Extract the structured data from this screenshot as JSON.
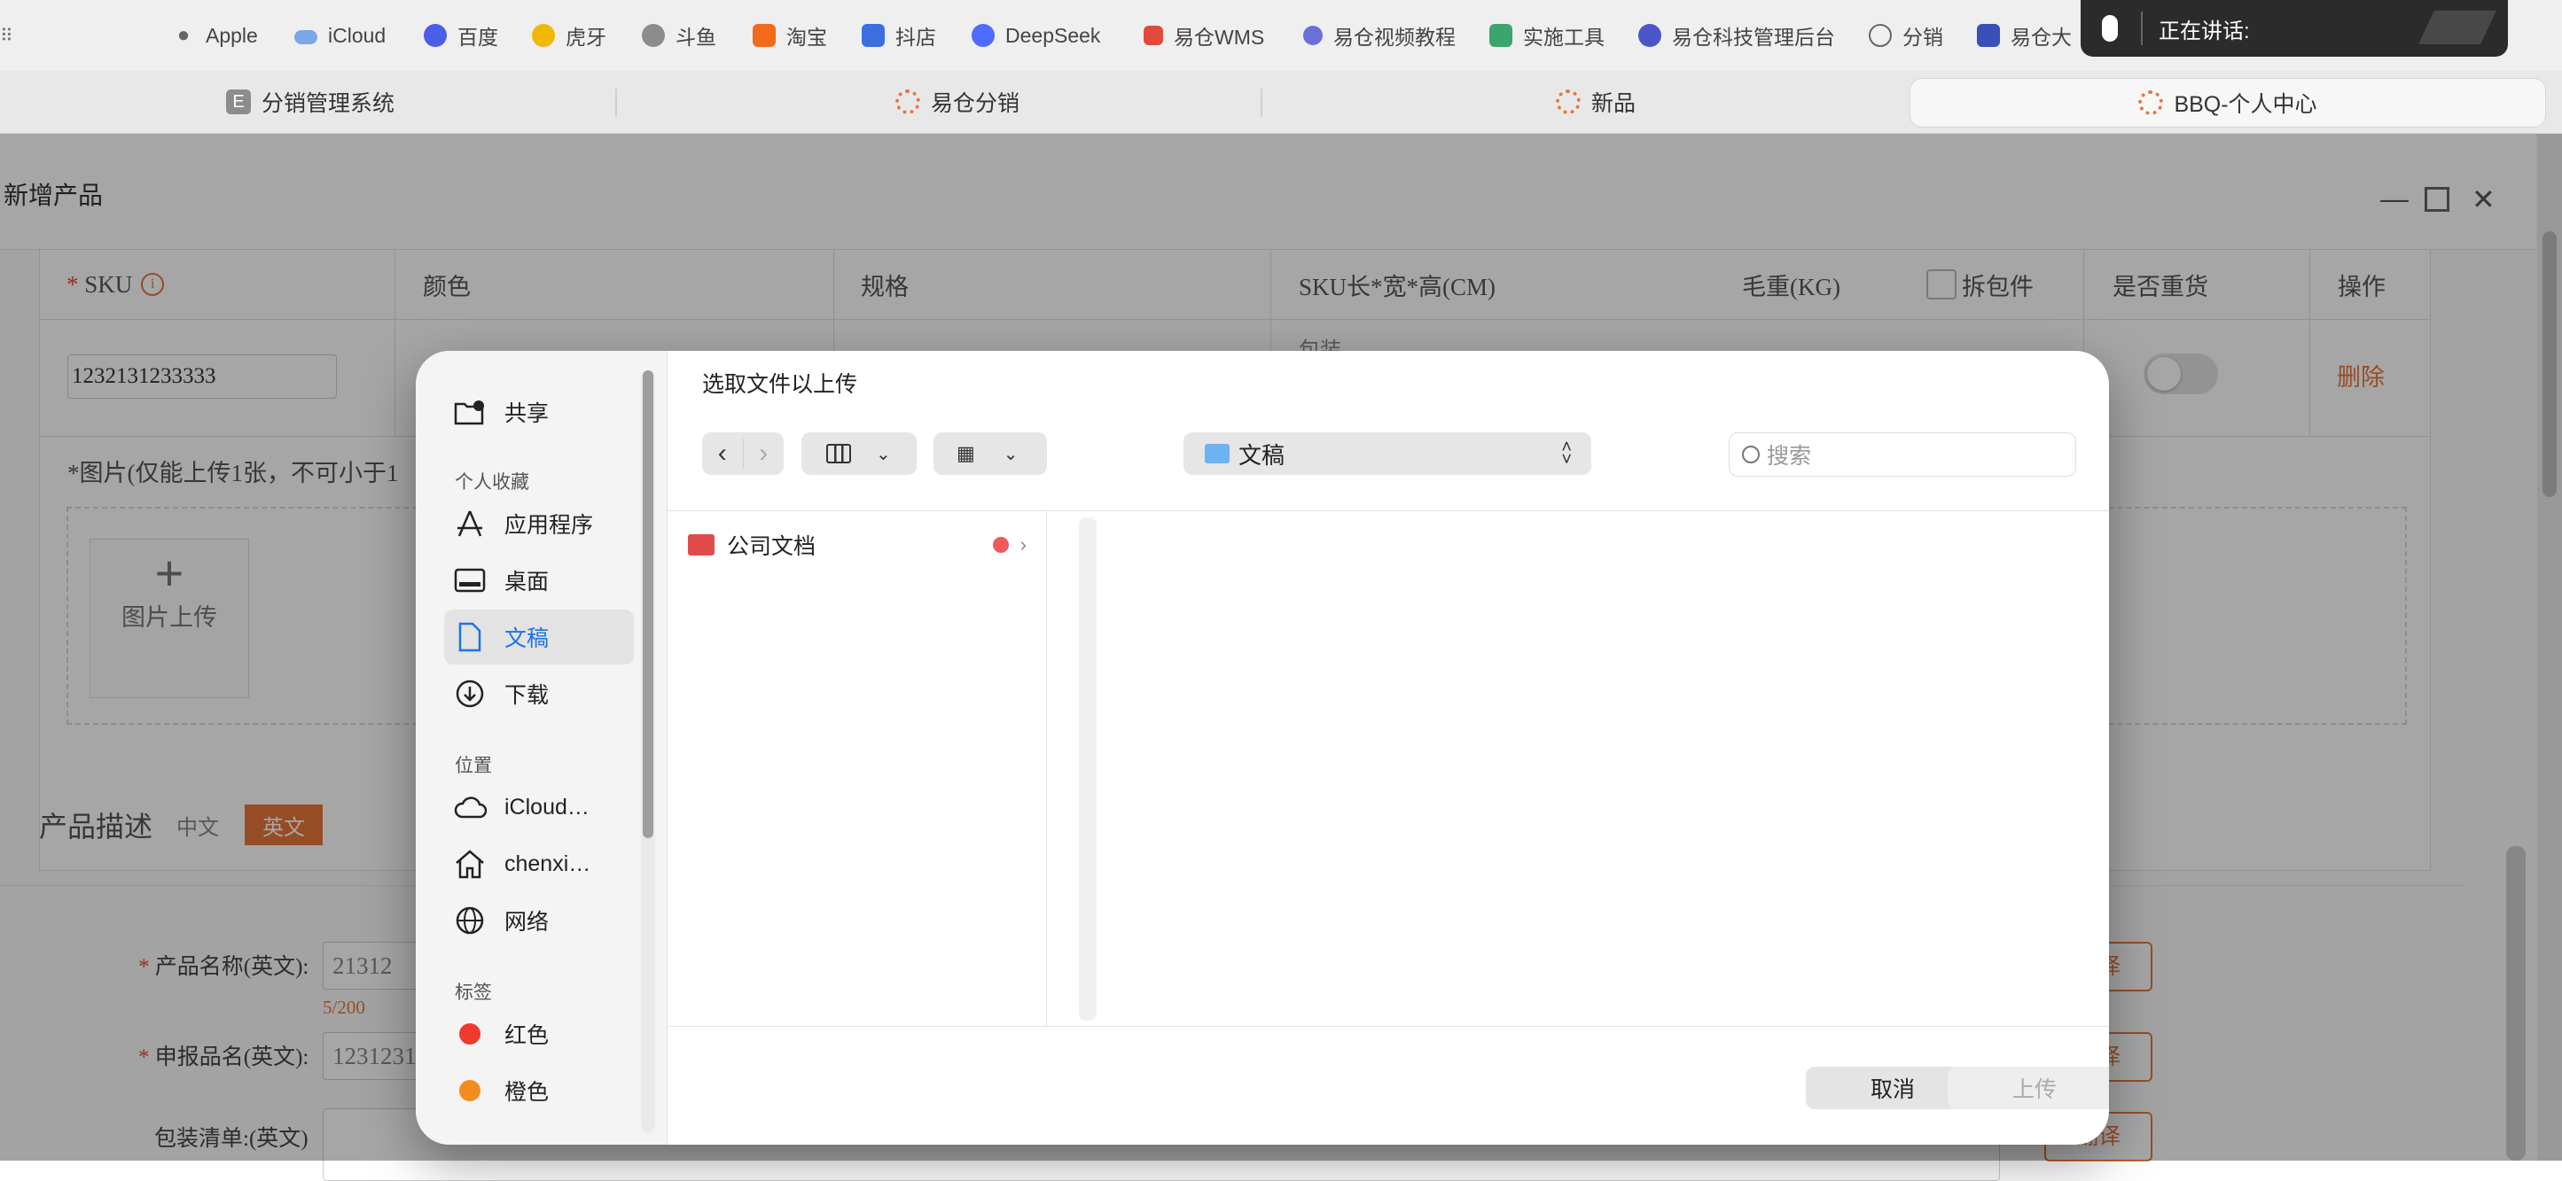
{
  "bookmarks": [
    {
      "label": "Apple",
      "icon": "apple-icon"
    },
    {
      "label": "iCloud",
      "icon": "cloud-icon"
    },
    {
      "label": "百度",
      "icon": "baidu-icon"
    },
    {
      "label": "虎牙",
      "icon": "huya-icon"
    },
    {
      "label": "斗鱼",
      "icon": "douyu-icon"
    },
    {
      "label": "淘宝",
      "icon": "taobao-icon"
    },
    {
      "label": "抖店",
      "icon": "doudian-icon"
    },
    {
      "label": "DeepSeek",
      "icon": "deepseek-icon"
    },
    {
      "label": "易仓WMS",
      "icon": "wms-icon"
    },
    {
      "label": "易仓视频教程",
      "icon": "video-icon"
    },
    {
      "label": "实施工具",
      "icon": "tool-icon"
    },
    {
      "label": "易仓科技管理后台",
      "icon": "admin-icon"
    },
    {
      "label": "分销",
      "icon": "globe-icon"
    },
    {
      "label": "易仓大",
      "icon": "tools-icon"
    }
  ],
  "tabs": [
    {
      "label": "分销管理系统",
      "active": false
    },
    {
      "label": "易仓分销",
      "active": false
    },
    {
      "label": "新品",
      "active": false
    },
    {
      "label": "BBQ-个人中心",
      "active": true
    }
  ],
  "speaking": {
    "label": "正在讲话:"
  },
  "modal": {
    "title": "新增产品",
    "table_headers": [
      "SKU",
      "颜色",
      "规格",
      "SKU长*宽*高(CM)",
      "毛重(KG)",
      "拆包件",
      "是否重货",
      "操作"
    ],
    "sku_value": "1232131233333",
    "size_prefix": "包装",
    "size_values": [
      "",
      "",
      ""
    ],
    "delete_label": "删除",
    "image_note": "*图片(仅能上传1张，不可小于1",
    "upload_label": "图片上传",
    "desc_label": "产品描述",
    "lang_tabs": [
      "中文",
      "英文"
    ],
    "fields": [
      {
        "label": "产品名称(英文):",
        "value": "21312",
        "counter": "5/200",
        "required": true
      },
      {
        "label": "申报品名(英文):",
        "value": "1231231",
        "required": true
      },
      {
        "label": "包装清单:(英文)",
        "value": "",
        "required": false
      }
    ],
    "translate_label": "翻译"
  },
  "dialog": {
    "title": "选取文件以上传",
    "location": "文稿",
    "search_placeholder": "搜索",
    "sidebar": {
      "shared": "共享",
      "favorites_header": "个人收藏",
      "favorites": [
        {
          "label": "应用程序",
          "icon": "applications-icon"
        },
        {
          "label": "桌面",
          "icon": "desktop-icon"
        },
        {
          "label": "文稿",
          "icon": "document-icon",
          "selected": true
        },
        {
          "label": "下载",
          "icon": "download-icon"
        }
      ],
      "locations_header": "位置",
      "locations": [
        {
          "label": "iCloud…",
          "icon": "icloud-icon"
        },
        {
          "label": "chenxi…",
          "icon": "home-icon"
        },
        {
          "label": "网络",
          "icon": "network-icon"
        }
      ],
      "tags_header": "标签",
      "tags": [
        {
          "label": "红色",
          "color": "#f03a2e"
        },
        {
          "label": "橙色",
          "color": "#f28c1c"
        }
      ]
    },
    "files": [
      {
        "name": "公司文档",
        "tag_color": "#f05a5a"
      }
    ],
    "cancel_label": "取消",
    "upload_label": "上传"
  }
}
